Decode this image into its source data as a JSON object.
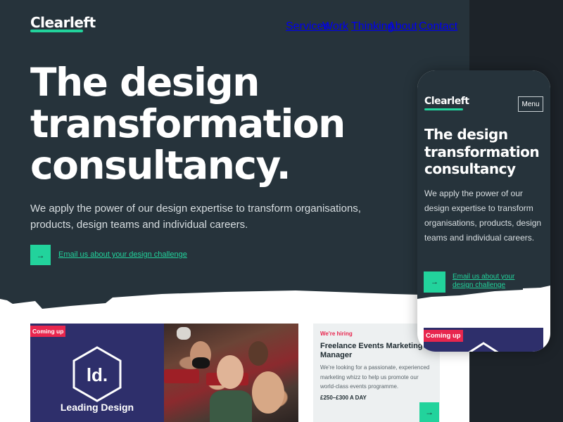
{
  "desktop": {
    "logo": "Clearleft",
    "nav": [
      "Services",
      "Work",
      "Thinking",
      "About",
      "Contact"
    ],
    "hero": {
      "title_lines": [
        "The design",
        "transformation",
        "consultancy."
      ],
      "description": "We apply the power of our design expertise to transform organisations, products, design teams and individual careers.",
      "cta_label": "Email us about your design challenge",
      "cta_icon": "→"
    },
    "event_card": {
      "badge": "Coming up",
      "logo_text": "ld.",
      "name": "Leading Design"
    },
    "job_card": {
      "tag": "We're hiring",
      "title": "Freelance Events Marketing Manager",
      "description": "We're looking for a passionate, experienced marketing whizz to help us promote our world-class events programme.",
      "rate": "£250–£300 A DAY",
      "button_icon": "→"
    }
  },
  "mobile": {
    "logo": "Clearleft",
    "menu_label": "Menu",
    "hero": {
      "title_lines": [
        "The design",
        "transformation",
        "consultancy"
      ],
      "description": "We apply the power of our design expertise to transform organisations, products, design teams and individual careers.",
      "cta_label": "Email us about your design challenge",
      "cta_icon": "→"
    },
    "event_badge": "Coming up"
  },
  "colors": {
    "hero_bg": "#26333b",
    "outer_bg": "#1d2329",
    "accent": "#22d39c",
    "badge": "#e8264e",
    "event_bg": "#2e2f6b",
    "card_bg": "#edf0f1"
  }
}
